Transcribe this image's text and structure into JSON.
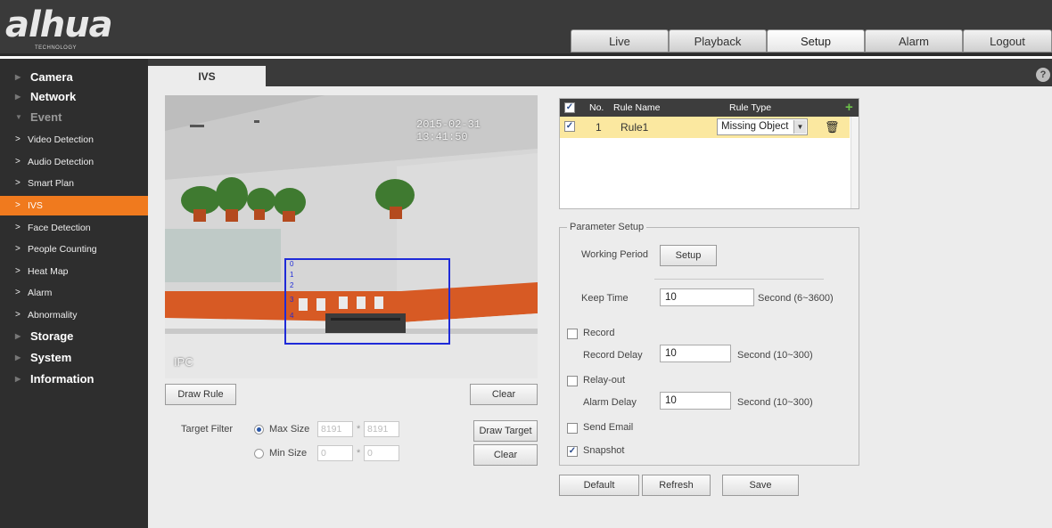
{
  "brand": {
    "name": "alhua",
    "sub": "TECHNOLOGY"
  },
  "nav": {
    "live": "Live",
    "playback": "Playback",
    "setup": "Setup",
    "alarm": "Alarm",
    "logout": "Logout"
  },
  "sidebar": {
    "camera": "Camera",
    "network": "Network",
    "event": "Event",
    "sub": [
      "Video Detection",
      "Audio Detection",
      "Smart Plan",
      "IVS",
      "Face Detection",
      "People Counting",
      "Heat Map",
      "Alarm",
      "Abnormality"
    ],
    "storage": "Storage",
    "system": "System",
    "information": "Information"
  },
  "tab": {
    "title": "IVS",
    "help": "?"
  },
  "video": {
    "timestamp": "2015-02-31 13:41:50",
    "channel": "IPC"
  },
  "buttons": {
    "draw_rule": "Draw Rule",
    "clear": "Clear",
    "draw_target": "Draw Target",
    "clear2": "Clear"
  },
  "target_filter": {
    "label": "Target Filter",
    "max_label": "Max Size",
    "max_w": "8191",
    "max_h": "8191",
    "min_label": "Min Size",
    "min_w": "0",
    "min_h": "0",
    "x": "*"
  },
  "rule_table": {
    "col_no": "No.",
    "col_name": "Rule Name",
    "col_type": "Rule Type",
    "add": "+",
    "rows": [
      {
        "no": "1",
        "name": "Rule1",
        "type": "Missing Object"
      }
    ]
  },
  "param": {
    "legend": "Parameter Setup",
    "working_period": "Working Period",
    "setup_btn": "Setup",
    "keep_time": "Keep Time",
    "keep_time_val": "10",
    "keep_time_unit": "Second (6~3600)",
    "record": "Record",
    "record_delay": "Record Delay",
    "record_delay_val": "10",
    "record_delay_unit": "Second (10~300)",
    "relay_out": "Relay-out",
    "alarm_delay": "Alarm Delay",
    "alarm_delay_val": "10",
    "alarm_delay_unit": "Second (10~300)",
    "send_email": "Send Email",
    "snapshot": "Snapshot"
  },
  "footer": {
    "default": "Default",
    "refresh": "Refresh",
    "save": "Save"
  },
  "colors": {
    "accent": "#f07a1e",
    "rule_box": "#1f2bd8",
    "selected_row": "#fbe8a0"
  }
}
